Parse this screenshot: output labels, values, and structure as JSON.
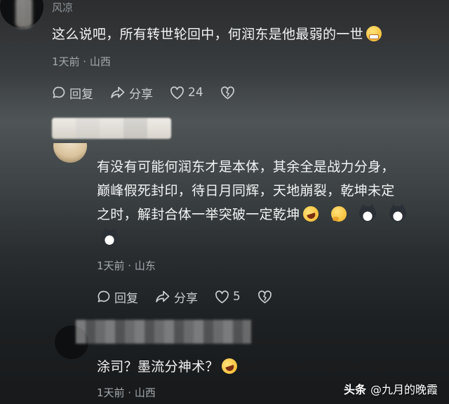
{
  "comments": [
    {
      "username": "风凉",
      "text": "这么说吧，所有转世轮回中，何润东是他最弱的一世",
      "emojis": [
        "grinning-face"
      ],
      "location": "1天前 · 山西",
      "reply_label": "回复",
      "share_label": "分享",
      "likes": "24"
    },
    {
      "lines": [
        "有没有可能何润东才是本体，其余全是战力分身，",
        "巅峰假死封印，待日月同辉，天地崩裂，乾坤未定",
        "之时，解封合体一举突破一定乾坤"
      ],
      "emojis": [
        "rolling-laughing-face",
        "thinking-face",
        "cat-face",
        "cat-face",
        "cat-face"
      ],
      "location": "1天前 · 山东",
      "reply_label": "回复",
      "share_label": "分享",
      "likes": "5"
    },
    {
      "text": "涂司？墨流分神术？",
      "emojis": [
        "rolling-laughing-face"
      ],
      "location": "1天前 · 山西"
    }
  ],
  "watermark": {
    "brand": "头条",
    "author": "@九月的晚霞"
  }
}
